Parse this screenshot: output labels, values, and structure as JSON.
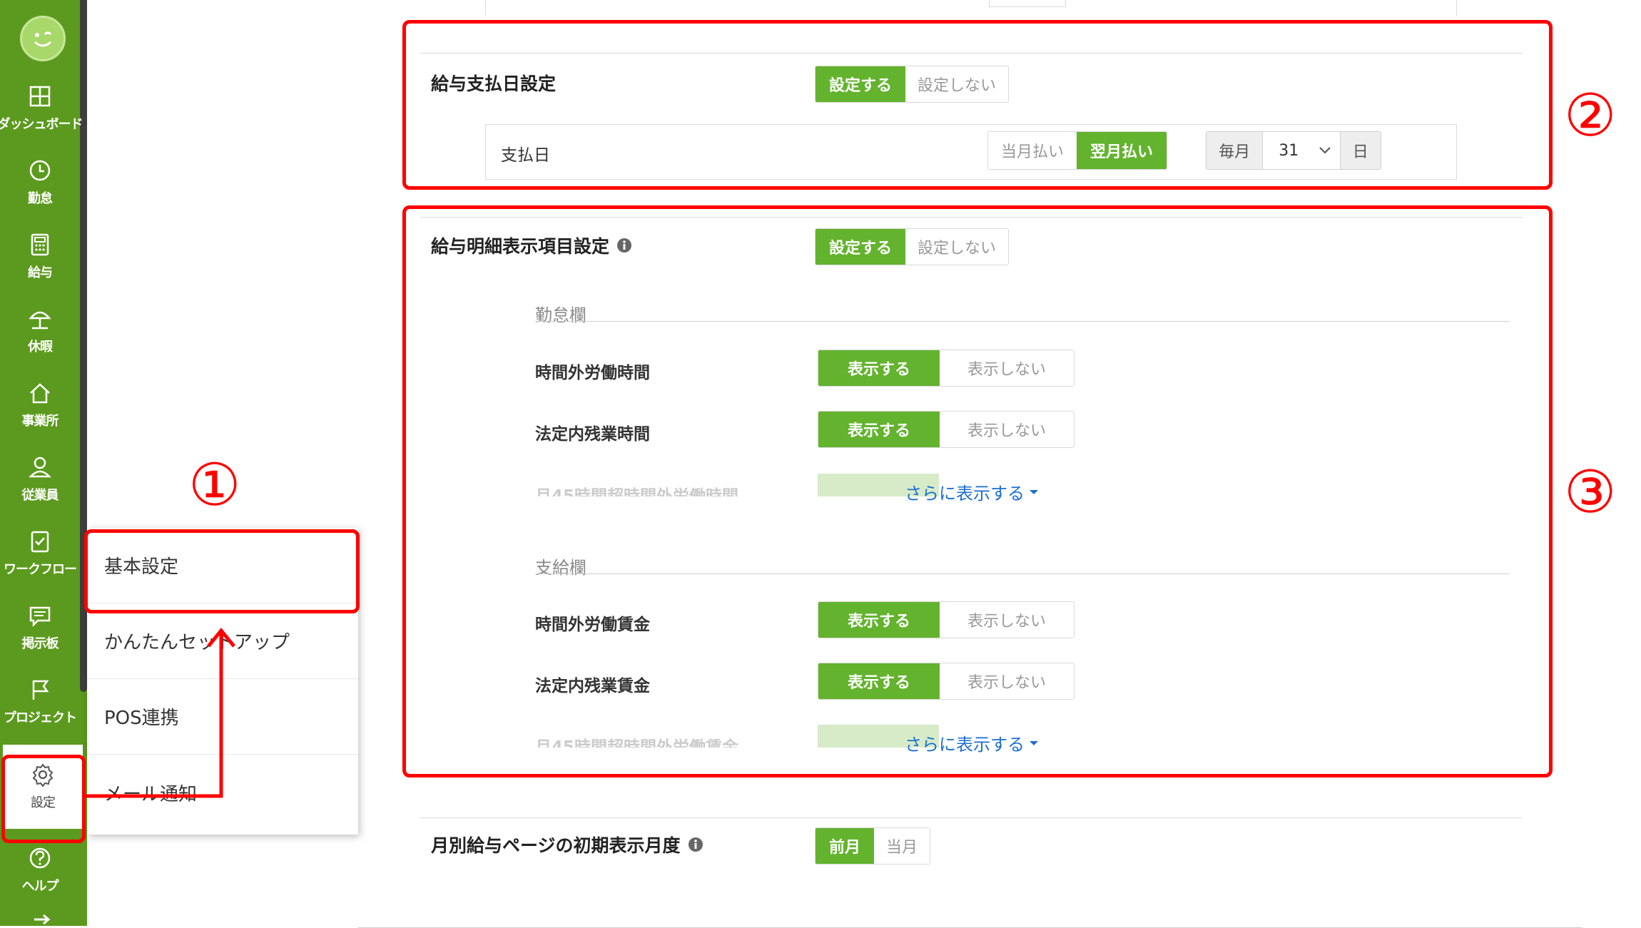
{
  "sidebar": {
    "items": [
      {
        "label": "ダッシュボード",
        "icon": "dashboard-icon"
      },
      {
        "label": "勤怠",
        "icon": "clock-icon"
      },
      {
        "label": "給与",
        "icon": "calculator-icon"
      },
      {
        "label": "休暇",
        "icon": "beach-umbrella-icon"
      },
      {
        "label": "事業所",
        "icon": "home-icon"
      },
      {
        "label": "従業員",
        "icon": "person-icon"
      },
      {
        "label": "ワークフロー",
        "icon": "clipboard-icon"
      },
      {
        "label": "掲示板",
        "icon": "chat-icon"
      },
      {
        "label": "プロジェクト",
        "icon": "flag-icon"
      },
      {
        "label": "設定",
        "icon": "gear-icon"
      },
      {
        "label": "ヘルプ",
        "icon": "help-icon"
      }
    ]
  },
  "menu": {
    "items": [
      "基本設定",
      "かんたんセットアップ",
      "POS連携",
      "メール通知"
    ]
  },
  "pay_date": {
    "title": "給与支払日設定",
    "opt_on": "設定する",
    "opt_off": "設定しない",
    "row_label": "支払日",
    "month_this": "当月払い",
    "month_next": "翌月払い",
    "every": "毎月",
    "day_value": "31",
    "day_unit": "日"
  },
  "payslip": {
    "title": "給与明細表示項目設定",
    "opt_on": "設定する",
    "opt_off": "設定しない",
    "attendance": {
      "heading": "勤怠欄",
      "rows": [
        "時間外労働時間",
        "法定内残業時間",
        "月45時間超時間外労働時間"
      ]
    },
    "payment": {
      "heading": "支給欄",
      "rows": [
        "時間外労働賃金",
        "法定内残業賃金",
        "月45時間超時間外労働賃金"
      ]
    },
    "show": "表示する",
    "hide": "表示しない",
    "more": "さらに表示する"
  },
  "initial_month": {
    "title": "月別給与ページの初期表示月度",
    "prev": "前月",
    "current": "当月"
  },
  "annotations": {
    "one": "①",
    "two": "②",
    "three": "③"
  },
  "colors": {
    "sidebar": "#5b9a1e",
    "accent": "#63b32e",
    "annotation": "#ff0000",
    "link": "#1a6fd0"
  }
}
